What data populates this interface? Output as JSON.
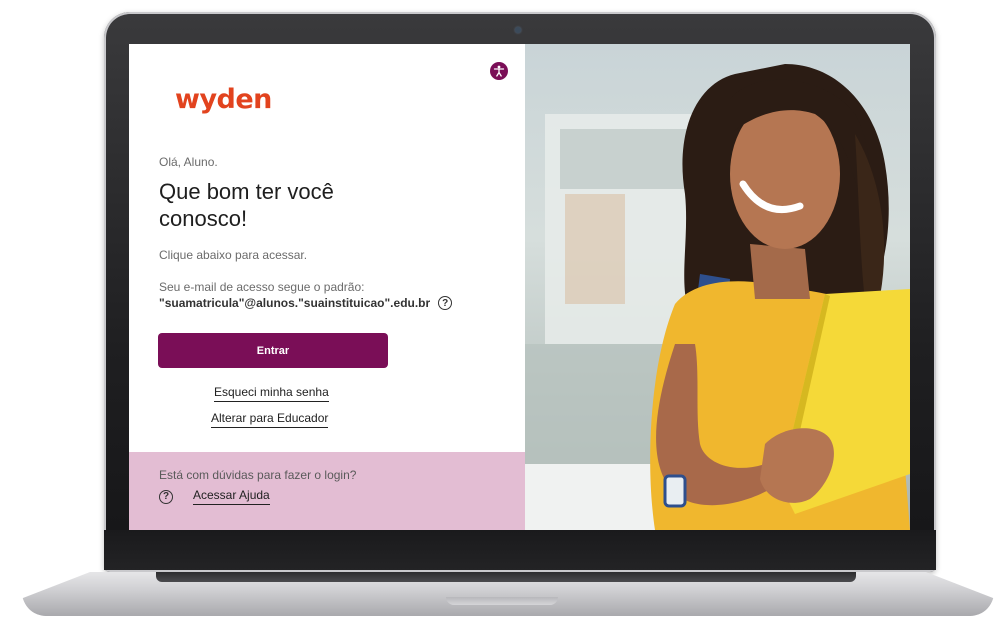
{
  "brand": {
    "logo_text": "wyden",
    "accent_color": "#7a0e57",
    "logo_color": "#e2431e",
    "help_bg": "#e3bdd3"
  },
  "login": {
    "greeting": "Olá, Aluno.",
    "headline": "Que bom ter você conosco!",
    "instruction": "Clique abaixo para acessar.",
    "email_info": "Seu e-mail de acesso segue o padrão:",
    "email_pattern": "\"suamatricula\"@alunos.\"suainstituicao\".edu.br",
    "enter_label": "Entrar",
    "forgot_link": "Esqueci minha senha",
    "educator_link": "Alterar para Educador"
  },
  "help": {
    "question": "Está com dúvidas para fazer o login?",
    "link_label": "Acessar Ajuda"
  },
  "icons": {
    "accessibility": "accessibility-icon",
    "email_help": "question-circle-icon",
    "help": "question-circle-icon"
  }
}
